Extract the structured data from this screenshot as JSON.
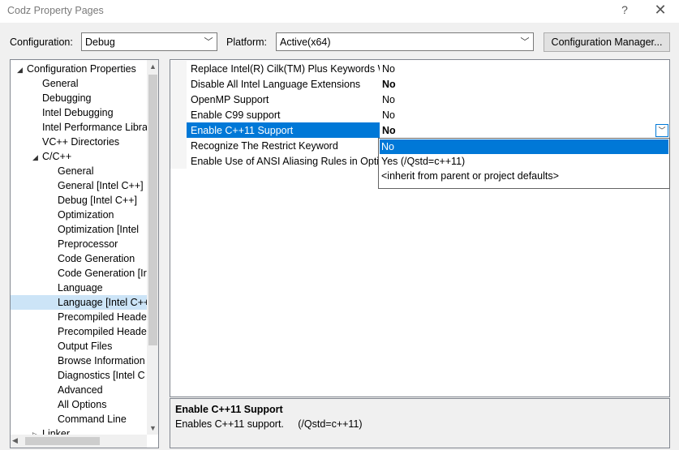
{
  "window": {
    "title": "Codz Property Pages",
    "help": "?",
    "close": "✕"
  },
  "toolbar": {
    "configuration_label": "Configuration:",
    "configuration_value": "Debug",
    "platform_label": "Platform:",
    "platform_value": "Active(x64)",
    "config_manager_button": "Configuration Manager..."
  },
  "tree": {
    "items": [
      {
        "label": "Configuration Properties",
        "level": 0,
        "expanded": true
      },
      {
        "label": "General",
        "level": 1
      },
      {
        "label": "Debugging",
        "level": 1
      },
      {
        "label": "Intel Debugging",
        "level": 1
      },
      {
        "label": "Intel Performance Libra",
        "level": 1
      },
      {
        "label": "VC++ Directories",
        "level": 1
      },
      {
        "label": "C/C++",
        "level": 1,
        "expanded": true
      },
      {
        "label": "General",
        "level": 2
      },
      {
        "label": "General [Intel C++]",
        "level": 2
      },
      {
        "label": "Debug [Intel C++]",
        "level": 2
      },
      {
        "label": "Optimization",
        "level": 2
      },
      {
        "label": "Optimization [Intel",
        "level": 2
      },
      {
        "label": "Preprocessor",
        "level": 2
      },
      {
        "label": "Code Generation",
        "level": 2
      },
      {
        "label": "Code Generation [Ir",
        "level": 2
      },
      {
        "label": "Language",
        "level": 2
      },
      {
        "label": "Language [Intel C++",
        "level": 2,
        "selected": true
      },
      {
        "label": "Precompiled Heade",
        "level": 2
      },
      {
        "label": "Precompiled Heade",
        "level": 2
      },
      {
        "label": "Output Files",
        "level": 2
      },
      {
        "label": "Browse Information",
        "level": 2
      },
      {
        "label": "Diagnostics [Intel C",
        "level": 2
      },
      {
        "label": "Advanced",
        "level": 2
      },
      {
        "label": "All Options",
        "level": 2
      },
      {
        "label": "Command Line",
        "level": 2
      },
      {
        "label": "Linker",
        "level": 1,
        "collapsed": true
      }
    ]
  },
  "properties": {
    "rows": [
      {
        "name": "Replace Intel(R) Cilk(TM) Plus Keywords With Serial Equivalents",
        "value": "No",
        "bold": false
      },
      {
        "name": "Disable All Intel Language Extensions",
        "value": "No",
        "bold": true
      },
      {
        "name": "OpenMP Support",
        "value": "No",
        "bold": false
      },
      {
        "name": "Enable C99 support",
        "value": "No",
        "bold": false
      },
      {
        "name": "Enable C++11 Support",
        "value": "No",
        "bold": true,
        "selected": true
      },
      {
        "name": "Recognize The Restrict Keyword",
        "value": "",
        "bold": false
      },
      {
        "name": "Enable Use of ANSI Aliasing Rules in Optimizations",
        "value": "",
        "bold": false
      }
    ]
  },
  "dropdown": {
    "options": [
      {
        "label": "No",
        "selected": true
      },
      {
        "label": "Yes (/Qstd=c++11)"
      },
      {
        "label": "<inherit from parent or project defaults>"
      }
    ]
  },
  "description": {
    "title": "Enable C++11 Support",
    "text": "Enables C++11 support.     (/Qstd=c++11)"
  }
}
